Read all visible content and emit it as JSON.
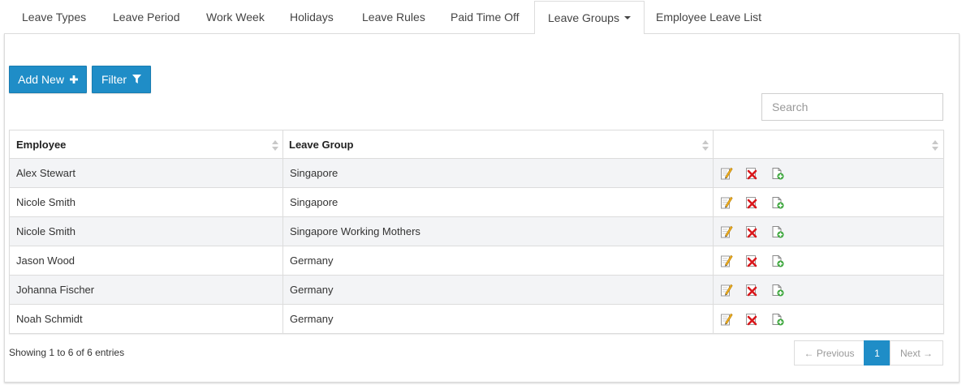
{
  "tabs": [
    {
      "label": "Leave Types"
    },
    {
      "label": "Leave Period"
    },
    {
      "label": "Work Week"
    },
    {
      "label": "Holidays"
    },
    {
      "label": "Leave Rules"
    },
    {
      "label": "Paid Time Off"
    },
    {
      "label": "Leave Groups",
      "active": true,
      "dropdown": true
    },
    {
      "label": "Employee Leave List"
    }
  ],
  "toolbar": {
    "add_label": "Add New",
    "add_icon": "plus-icon",
    "filter_label": "Filter",
    "filter_icon": "funnel-icon",
    "search_placeholder": "Search"
  },
  "table": {
    "columns": [
      "Employee",
      "Leave Group",
      ""
    ],
    "rows": [
      {
        "employee": "Alex Stewart",
        "group": "Singapore"
      },
      {
        "employee": "Nicole Smith",
        "group": "Singapore"
      },
      {
        "employee": "Nicole Smith",
        "group": "Singapore Working Mothers"
      },
      {
        "employee": "Jason Wood",
        "group": "Germany"
      },
      {
        "employee": "Johanna Fischer",
        "group": "Germany"
      },
      {
        "employee": "Noah Schmidt",
        "group": "Germany"
      }
    ],
    "row_actions": [
      "edit-icon",
      "delete-icon",
      "copy-icon"
    ]
  },
  "footer": {
    "info": "Showing 1 to 6 of 6 entries",
    "previous": "← Previous",
    "page": "1",
    "next": "Next →"
  },
  "colors": {
    "accent": "#1f8dc7",
    "row_stripe": "#f3f4f6",
    "border": "#dcdcdc"
  }
}
